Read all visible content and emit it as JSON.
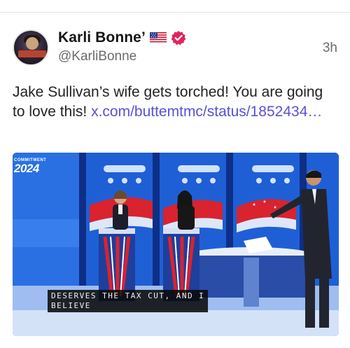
{
  "post": {
    "display_name": "Karli Bonne’",
    "handle": "@KarliBonne",
    "timestamp": "3h",
    "text": "Jake Sullivan’s wife gets torched! You are going to love this! ",
    "link_text": "x.com/buttemtmc/status/1852434…",
    "avatar_icon": "profile-avatar",
    "flag_icon": "us-flag-icon",
    "verified_icon": "verified-badge-icon",
    "colors": {
      "link": "#5b4fd6",
      "verified": "#e0245e",
      "secondary_text": "#6b6b6b"
    }
  },
  "media": {
    "logo_small": "COMMITMENT",
    "logo_year": "2024",
    "subtitle_line1": "DESERVES THE TAX CUT, AND I",
    "subtitle_line2": "BELIEVE"
  }
}
